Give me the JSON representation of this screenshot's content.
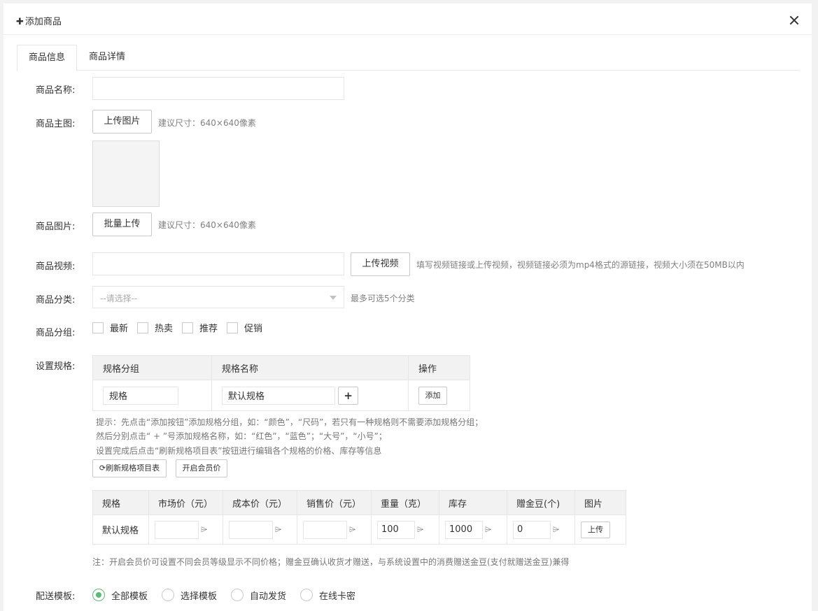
{
  "dialog": {
    "title": "添加商品"
  },
  "tabs": [
    {
      "label": "商品信息"
    },
    {
      "label": "商品详情"
    }
  ],
  "form": {
    "name": {
      "label": "商品名称:",
      "value": ""
    },
    "main_image": {
      "label": "商品主图:",
      "button": "上传图片",
      "hint": "建议尺寸：640×640像素"
    },
    "images": {
      "label": "商品图片:",
      "button": "批量上传",
      "hint": "建议尺寸：640×640像素"
    },
    "video": {
      "label": "商品视频:",
      "value": "",
      "button": "上传视频",
      "hint": "填写视频链接或上传视频，视频链接必须为mp4格式的源链接，视频大小须在50MB以内"
    },
    "category": {
      "label": "商品分类:",
      "placeholder": "--请选择--",
      "hint": "最多可选5个分类"
    },
    "group": {
      "label": "商品分组:",
      "options": [
        "最新",
        "热卖",
        "推荐",
        "促销"
      ]
    },
    "spec": {
      "label": "设置规格:",
      "headers": [
        "规格分组",
        "规格名称",
        "操作"
      ],
      "row": {
        "group": "规格",
        "name": "默认规格",
        "add_label": "添加"
      },
      "tips": [
        "提示：先点击“添加按钮”添加规格分组，如：“颜色”，“尺码”，若只有一种规格则不需要添加规格分组；",
        "然后分别点击“ + ”号添加规格名称，如：“红色”，“蓝色”；“大号”，“小号”；",
        "设置完成后点击“刷新规格项目表”按钮进行编辑各个规格的价格、库存等信息"
      ],
      "refresh_button": "刷新规格项目表",
      "member_price_button": "开启会员价"
    },
    "price_table": {
      "headers": [
        "规格",
        "市场价（元）",
        "成本价（元）",
        "销售价（元）",
        "重量（克）",
        "库存",
        "赠金豆(个)",
        "图片"
      ],
      "row": {
        "spec": "默认规格",
        "market": "",
        "cost": "",
        "sale": "",
        "weight": "100",
        "stock": "1000",
        "beans": "0",
        "upload": "上传"
      },
      "note": "注：开启会员价可设置不同会员等级显示不同价格；赠金豆确认收货才赠送，与系统设置中的消费赠送金豆(支付就赠送金豆)兼得"
    },
    "delivery": {
      "label": "配送模板:",
      "options": [
        "全部模板",
        "选择模板",
        "自动发货",
        "在线卡密"
      ],
      "selected": "全部模板"
    }
  },
  "colors": {
    "accent": "#5fb878",
    "border": "#e6e6e6",
    "header_bg": "#f2f2f2"
  }
}
